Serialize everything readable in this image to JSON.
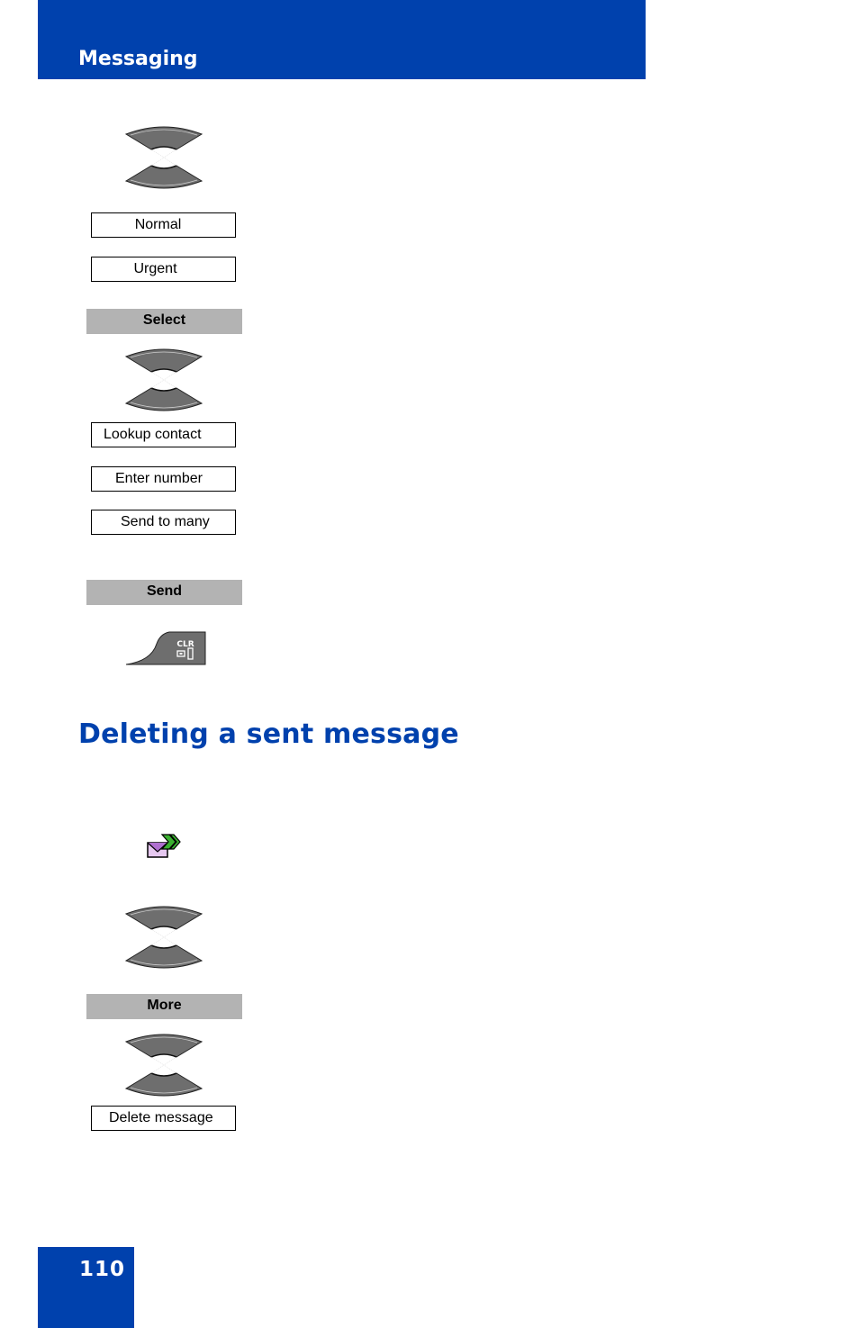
{
  "header": {
    "title": "Messaging"
  },
  "steps_top": {
    "priority_options": [
      "Normal",
      "Urgent"
    ],
    "select_softkey": "Select",
    "recipient_options": [
      "Lookup contact",
      "Enter number",
      "Send to many"
    ],
    "send_softkey": "Send",
    "clr_key_label": "CLR"
  },
  "section": {
    "title": "Deleting a sent message",
    "more_softkey": "More",
    "delete_option": "Delete message"
  },
  "footer": {
    "page_number": "110"
  },
  "colors": {
    "brand_blue": "#0041ad",
    "softkey_gray": "#b3b3b3"
  }
}
